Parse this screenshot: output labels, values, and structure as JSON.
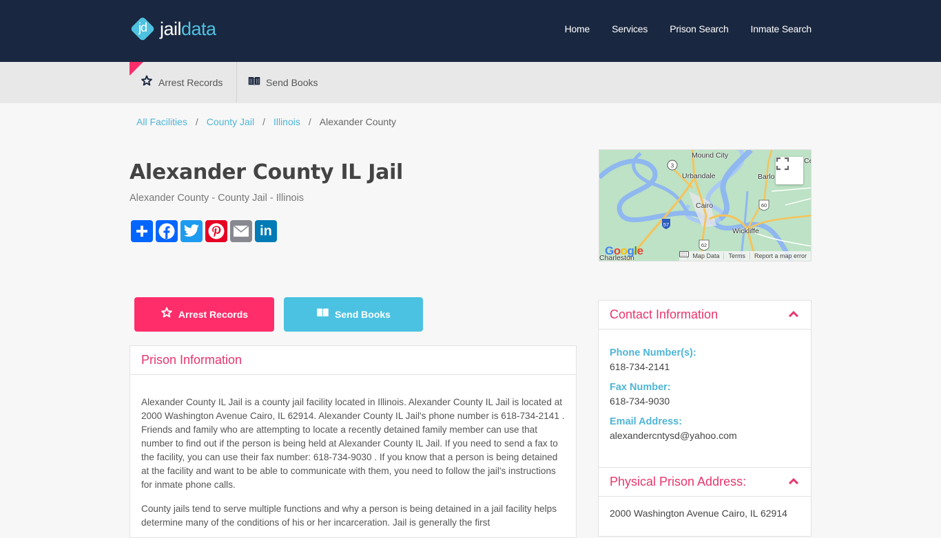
{
  "header": {
    "logo": {
      "mark": "jd",
      "text_part1": "jail",
      "text_part2": "data"
    },
    "nav": [
      {
        "label": "Home"
      },
      {
        "label": "Services"
      },
      {
        "label": "Prison Search"
      },
      {
        "label": "Inmate Search"
      }
    ]
  },
  "subnav": {
    "items": [
      {
        "label": "Arrest Records",
        "icon": "sheriff-star-icon"
      },
      {
        "label": "Send Books",
        "icon": "book-icon"
      }
    ]
  },
  "breadcrumb": {
    "items": [
      {
        "label": "All Facilities"
      },
      {
        "label": "County Jail"
      },
      {
        "label": "Illinois"
      }
    ],
    "separator": "/",
    "current": "Alexander County"
  },
  "page": {
    "title": "Alexander County IL Jail",
    "subtitle": "Alexander County - County Jail - Illinois"
  },
  "share": {
    "buttons": [
      {
        "name": "share",
        "glyph": "+"
      },
      {
        "name": "facebook",
        "glyph": "f"
      },
      {
        "name": "twitter",
        "glyph": "t"
      },
      {
        "name": "pinterest",
        "glyph": "P"
      },
      {
        "name": "email",
        "glyph": "✉"
      },
      {
        "name": "linkedin",
        "glyph": "in"
      }
    ]
  },
  "map": {
    "labels": [
      "Mound City",
      "Urbandale",
      "Barlo",
      "Cairo",
      "Wickliffe",
      "Charleston",
      "Ce"
    ],
    "route_shields": [
      "3",
      "57",
      "60",
      "62"
    ],
    "attribution": {
      "map_data": "Map Data",
      "terms": "Terms",
      "report": "Report a map error"
    },
    "google": "Google"
  },
  "actions": {
    "arrest_records": "Arrest Records",
    "send_books": "Send Books"
  },
  "prison_info": {
    "heading": "Prison Information",
    "paragraphs": [
      "Alexander County IL Jail is a county jail facility located in Illinois. Alexander County IL Jail is located at 2000 Washington Avenue Cairo, IL 62914. Alexander County IL Jail's phone number is 618-734-2141 . Friends and family who are attempting to locate a recently detained family member can use that number to find out if the person is being held at Alexander County IL Jail. If you need to send a fax to the facility, you can use their fax number: 618-734-9030 . If you know that a person is being detained at the facility and want to be able to communicate with them, you need to follow the jail's instructions for inmate phone calls.",
      "County jails tend to serve multiple functions and why a person is being detained in a jail facility helps determine many of the conditions of his or her incarceration. Jail is generally the first"
    ]
  },
  "contact": {
    "heading": "Contact Information",
    "phone_label": "Phone Number(s):",
    "phone": "618-734-2141",
    "fax_label": "Fax Number:",
    "fax": "618-734-9030",
    "email_label": "Email Address:",
    "email": "alexandercntysd@yahoo.com"
  },
  "address": {
    "heading": "Physical Prison Address:",
    "value": "2000 Washington Avenue Cairo, IL 62914"
  },
  "colors": {
    "header_bg": "#1a2740",
    "accent_pink": "#ff2d6a",
    "accent_blue": "#4bc2e2",
    "heading_pink": "#e8356c",
    "label_blue": "#4fb5d6"
  }
}
